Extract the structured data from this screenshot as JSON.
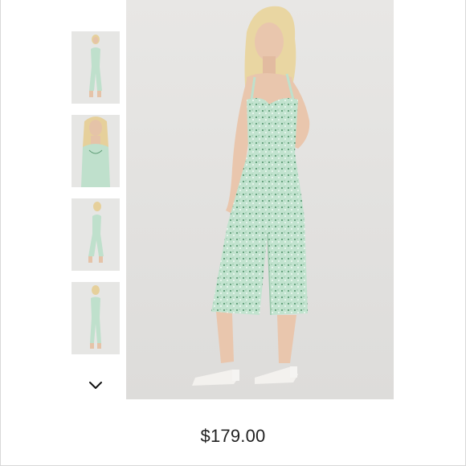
{
  "product": {
    "price": "$179.00"
  },
  "gallery": {
    "thumbnail_count": 4,
    "scroll_icon": "chevron-down-icon"
  },
  "colors": {
    "jumpsuit": "#bfe0cc",
    "jumpsuit_print": "#5f9d77",
    "background": "#e5e4e2",
    "hair": "#e9d6a2",
    "skin": "#e9c6ad"
  }
}
